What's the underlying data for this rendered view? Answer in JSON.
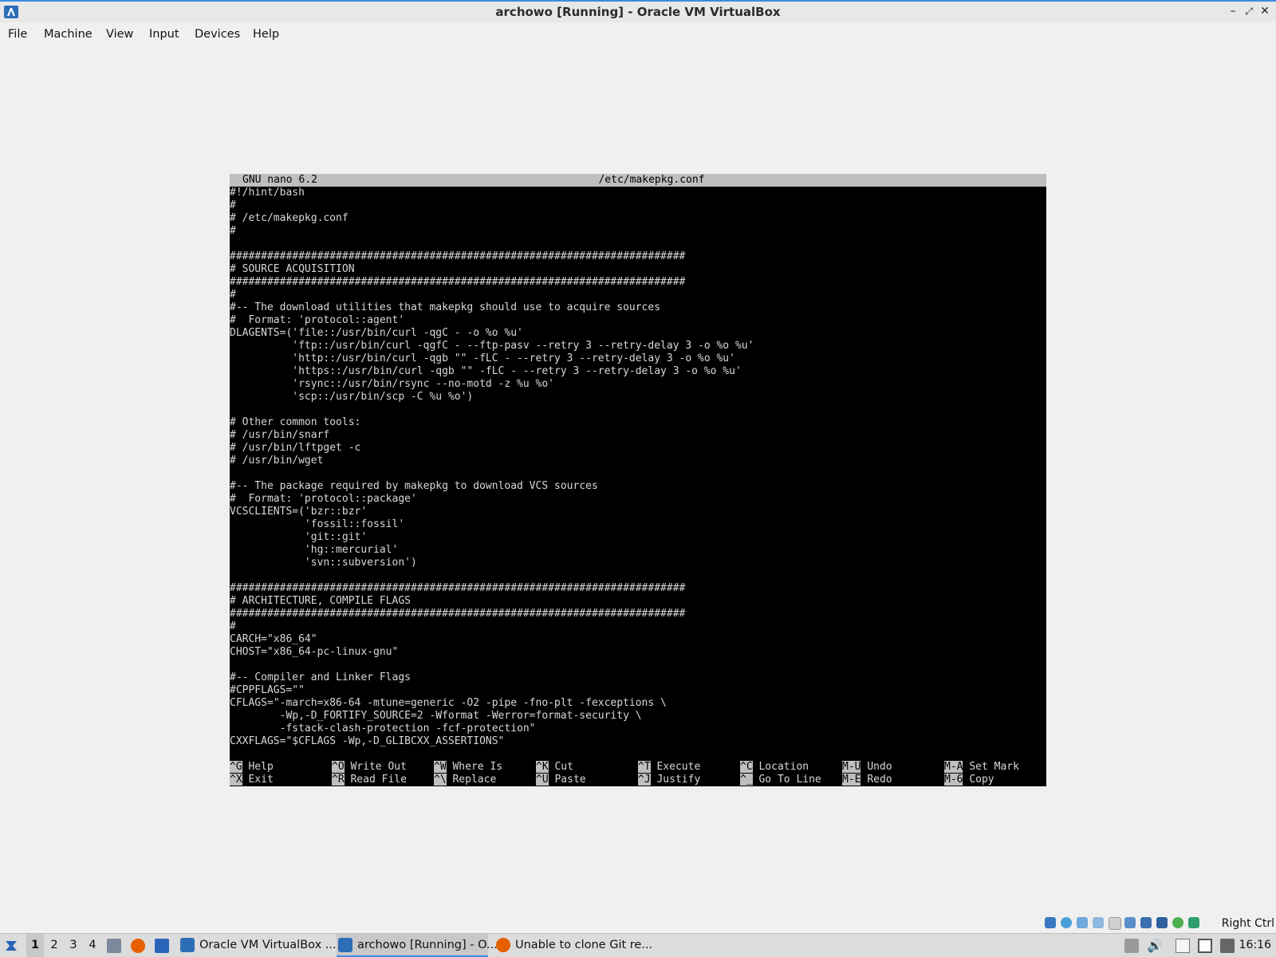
{
  "window": {
    "title": "archowo [Running] - Oracle VM VirtualBox"
  },
  "menu": [
    "File",
    "Machine",
    "View",
    "Input",
    "Devices",
    "Help"
  ],
  "nano": {
    "version": "GNU nano 6.2",
    "filename": "/etc/makepkg.conf",
    "lines": [
      "#!/hint/bash",
      "#",
      "# /etc/makepkg.conf",
      "#",
      "",
      "#########################################################################",
      "# SOURCE ACQUISITION",
      "#########################################################################",
      "#",
      "#-- The download utilities that makepkg should use to acquire sources",
      "#  Format: 'protocol::agent'",
      "DLAGENTS=('file::/usr/bin/curl -qgC - -o %o %u'",
      "          'ftp::/usr/bin/curl -qgfC - --ftp-pasv --retry 3 --retry-delay 3 -o %o %u'",
      "          'http::/usr/bin/curl -qgb \"\" -fLC - --retry 3 --retry-delay 3 -o %o %u'",
      "          'https::/usr/bin/curl -qgb \"\" -fLC - --retry 3 --retry-delay 3 -o %o %u'",
      "          'rsync::/usr/bin/rsync --no-motd -z %u %o'",
      "          'scp::/usr/bin/scp -C %u %o')",
      "",
      "# Other common tools:",
      "# /usr/bin/snarf",
      "# /usr/bin/lftpget -c",
      "# /usr/bin/wget",
      "",
      "#-- The package required by makepkg to download VCS sources",
      "#  Format: 'protocol::package'",
      "VCSCLIENTS=('bzr::bzr'",
      "            'fossil::fossil'",
      "            'git::git'",
      "            'hg::mercurial'",
      "            'svn::subversion')",
      "",
      "#########################################################################",
      "# ARCHITECTURE, COMPILE FLAGS",
      "#########################################################################",
      "#",
      "CARCH=\"x86_64\"",
      "CHOST=\"x86_64-pc-linux-gnu\"",
      "",
      "#-- Compiler and Linker Flags",
      "#CPPFLAGS=\"\"",
      "CFLAGS=\"-march=x86-64 -mtune=generic -O2 -pipe -fno-plt -fexceptions \\",
      "        -Wp,-D_FORTIFY_SOURCE=2 -Wformat -Werror=format-security \\",
      "        -fstack-clash-protection -fcf-protection\"",
      "CXXFLAGS=\"$CFLAGS -Wp,-D_GLIBCXX_ASSERTIONS\""
    ],
    "shortcuts": [
      {
        "key": "^G",
        "label": "Help"
      },
      {
        "key": "^X",
        "label": "Exit"
      },
      {
        "key": "^O",
        "label": "Write Out"
      },
      {
        "key": "^R",
        "label": "Read File"
      },
      {
        "key": "^W",
        "label": "Where Is"
      },
      {
        "key": "^\\",
        "label": "Replace"
      },
      {
        "key": "^K",
        "label": "Cut"
      },
      {
        "key": "^U",
        "label": "Paste"
      },
      {
        "key": "^T",
        "label": "Execute"
      },
      {
        "key": "^J",
        "label": "Justify"
      },
      {
        "key": "^C",
        "label": "Location"
      },
      {
        "key": "^_",
        "label": "Go To Line"
      },
      {
        "key": "M-U",
        "label": "Undo"
      },
      {
        "key": "M-E",
        "label": "Redo"
      },
      {
        "key": "M-A",
        "label": "Set Mark"
      },
      {
        "key": "M-6",
        "label": "Copy"
      }
    ]
  },
  "statusbar": {
    "host_key": "Right Ctrl"
  },
  "taskbar": {
    "workspaces": [
      "1",
      "2",
      "3",
      "4"
    ],
    "tasks": [
      {
        "label": "Oracle VM VirtualBox ...",
        "icon": "virtualbox-icon"
      },
      {
        "label": "archowo [Running] - O...",
        "icon": "virtualbox-vm-icon"
      },
      {
        "label": "Unable to clone Git re...",
        "icon": "firefox-icon"
      }
    ],
    "clock": "16:16"
  },
  "colors": {
    "accent": "#3b8de0",
    "terminal_bg": "#000000",
    "terminal_fg": "#d8d8d8",
    "nano_bar": "#bfbfbf"
  }
}
